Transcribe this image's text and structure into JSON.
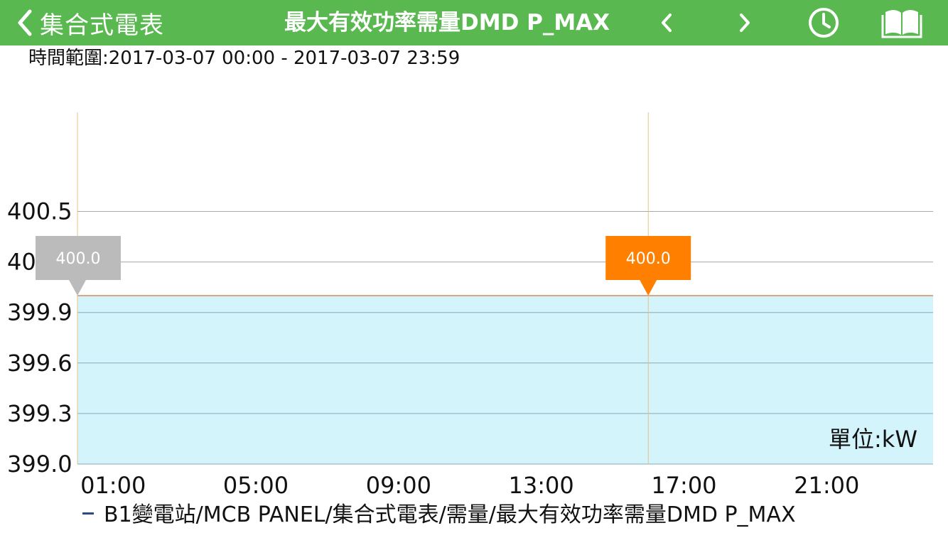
{
  "header": {
    "back_label": "集合式電表",
    "title": "最大有效功率需量DMD P_MAX",
    "bar_color": "#59b84f",
    "icons": {
      "back": "chevron-left-icon",
      "prev": "chevron-left-icon",
      "next": "chevron-right-icon",
      "history": "clock-icon",
      "manual": "book-icon"
    }
  },
  "time_range": {
    "label": "時間範圍:",
    "value": "2017-03-07 00:00 - 2017-03-07 23:59"
  },
  "unit": "單位:kW",
  "legend": {
    "label": "B1變電站/MCB PANEL/集合式電表/需量/最大有效功率需量DMD P_MAX",
    "color": "#2b4a8a"
  },
  "chart_data": {
    "type": "area",
    "x_ticks": [
      "01:00",
      "05:00",
      "09:00",
      "13:00",
      "17:00",
      "21:00"
    ],
    "y_ticks": [
      "399.0",
      "399.3",
      "399.6",
      "399.9",
      "40",
      "400.5"
    ],
    "xlim": [
      "00:00",
      "23:59"
    ],
    "ylim": [
      399.0,
      401.0
    ],
    "grid": true,
    "series": [
      {
        "values": [
          400.0,
          400.0
        ],
        "x": [
          "00:00",
          "23:59"
        ],
        "color": "#d3f4fa",
        "line_color": "#d9a87f"
      }
    ],
    "markers": [
      {
        "x": "00:00",
        "y": 400.0,
        "label": "400.0",
        "color": "#bbbbbb"
      },
      {
        "x": "16:00",
        "y": 400.0,
        "label": "400.0",
        "color": "#ff8000"
      }
    ]
  }
}
